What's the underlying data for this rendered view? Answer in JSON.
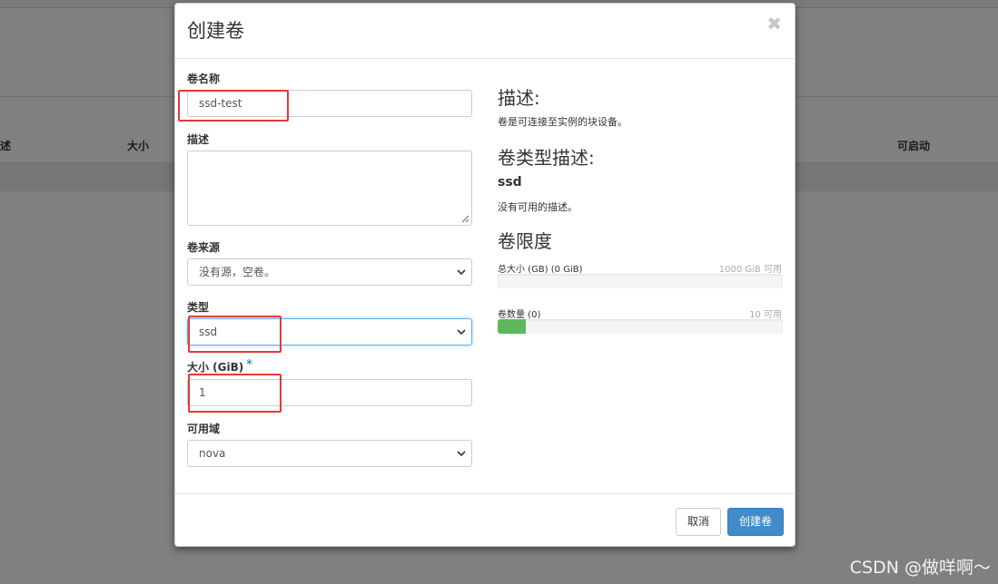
{
  "background": {
    "table_headers": [
      "描述",
      "大小",
      "可启动"
    ]
  },
  "modal": {
    "title": "创建卷",
    "close_glyph": "✖",
    "fields": {
      "name": {
        "label": "卷名称",
        "value": "ssd-test"
      },
      "description": {
        "label": "描述",
        "value": ""
      },
      "source": {
        "label": "卷来源",
        "value": "没有源，空卷。"
      },
      "type": {
        "label": "类型",
        "value": "ssd"
      },
      "size": {
        "label": "大小 (GiB)",
        "required_mark": "*",
        "value": "1"
      },
      "availability_zone": {
        "label": "可用域",
        "value": "nova"
      }
    },
    "help": {
      "desc_title": "描述:",
      "desc_text": "卷是可连接至实例的块设备。",
      "type_desc_title": "卷类型描述:",
      "type_name": "ssd",
      "type_desc_text": "没有可用的描述。",
      "limits_title": "卷限度",
      "quota_size": {
        "label": "总大小 (GB) (0 GiB)",
        "available": "1000 GiB 可用",
        "fraction_used": 0.0
      },
      "quota_count": {
        "label": "卷数量 (0)",
        "available": "10 可用",
        "fraction_used": 0.1
      }
    },
    "footer": {
      "cancel_label": "取消",
      "submit_label": "创建卷"
    }
  },
  "colors": {
    "primary": "#428bca",
    "highlight": "#e53935",
    "progress": "#5cb85c"
  },
  "watermark": "CSDN @做咩啊～"
}
